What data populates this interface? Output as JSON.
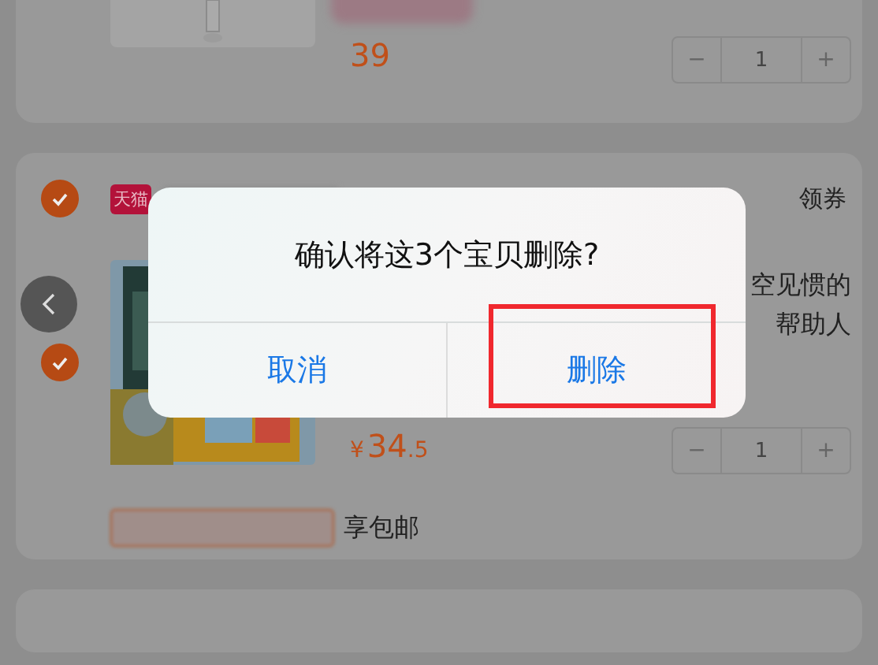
{
  "stores": [
    {
      "items": [
        {
          "price": "39",
          "quantity": "1",
          "decrement": "−",
          "increment": "+"
        }
      ]
    },
    {
      "checked": true,
      "badge": "天猫",
      "coupon": "领券",
      "items": [
        {
          "checked": true,
          "title_lines": [
            "空见惯的",
            "帮助人"
          ],
          "currency": "¥",
          "price": "34",
          "price_decimal": ".5",
          "quantity": "1",
          "decrement": "−",
          "increment": "+"
        }
      ],
      "shipping_note": "享包邮"
    }
  ],
  "dialog": {
    "message": "确认将这3个宝贝删除?",
    "buttons": [
      {
        "label": "取消",
        "highlighted": false
      },
      {
        "label": "删除",
        "highlighted": true
      }
    ]
  }
}
